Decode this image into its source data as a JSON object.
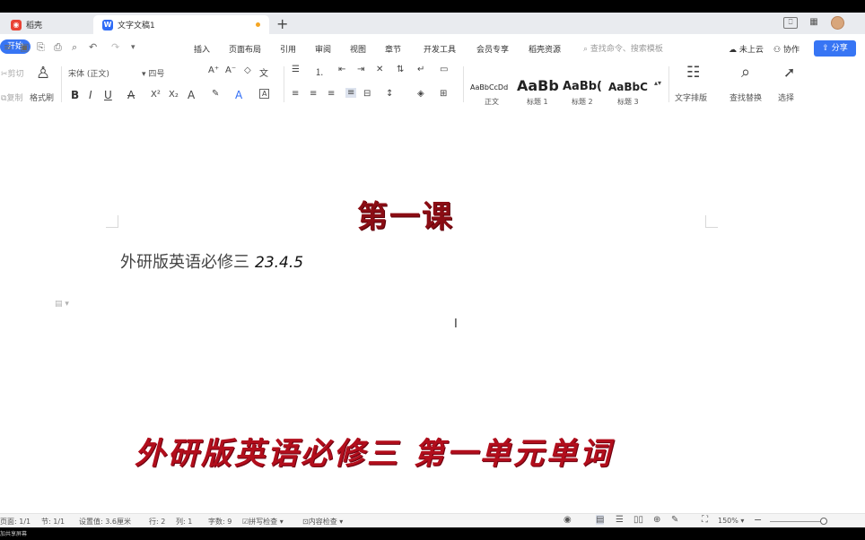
{
  "tabs": [
    {
      "label": "稻壳",
      "icon": "daoke-logo-icon",
      "color": "#e94235"
    },
    {
      "label": "文字文稿1",
      "icon": "wps-writer-icon",
      "color": "#2f6cf6",
      "modified": true
    }
  ],
  "top_right": {
    "window_icon_1": "⎕",
    "window_icon_2": "▦"
  },
  "menu": {
    "items": [
      "开始",
      "插入",
      "页面布局",
      "引用",
      "审阅",
      "视图",
      "章节",
      "开发工具",
      "会员专享",
      "稻壳资源"
    ],
    "search_placeholder": "查找命令、搜索模板",
    "upload_label": "未上云",
    "collab_label": "协作",
    "share_label": "分享"
  },
  "ribbon": {
    "cut": "剪切",
    "copy": "复制",
    "format_painter": "格式刷",
    "font_name": "宋体 (正文)",
    "font_size": "四号",
    "styles": [
      {
        "preview": "AaBbCcDd",
        "label": "正文"
      },
      {
        "preview": "AaBb",
        "label": "标题 1"
      },
      {
        "preview": "AaBb(",
        "label": "标题 2"
      },
      {
        "preview": "AaBbC",
        "label": "标题 3"
      }
    ],
    "text_layout": "文字排版",
    "find_replace": "查找替换",
    "select": "选择"
  },
  "document": {
    "title": "第一课",
    "subtitle": "外研版英语必修三",
    "date": "23.4.5",
    "caption": "外研版英语必修三 第一单元单词"
  },
  "status": {
    "page": "页面: 1/1",
    "section": "节: 1/1",
    "setting": "设置值: 3.6厘米",
    "row": "行: 2",
    "col": "列: 1",
    "words": "字数: 9",
    "spell_check": "拼写检查",
    "content_check": "内容检查",
    "zoom": "150%"
  },
  "colors": {
    "accent": "#3775f4",
    "title_red": "#8b0d14",
    "caption_red": "#b20e1c"
  },
  "footer_label": "加共享屏幕"
}
